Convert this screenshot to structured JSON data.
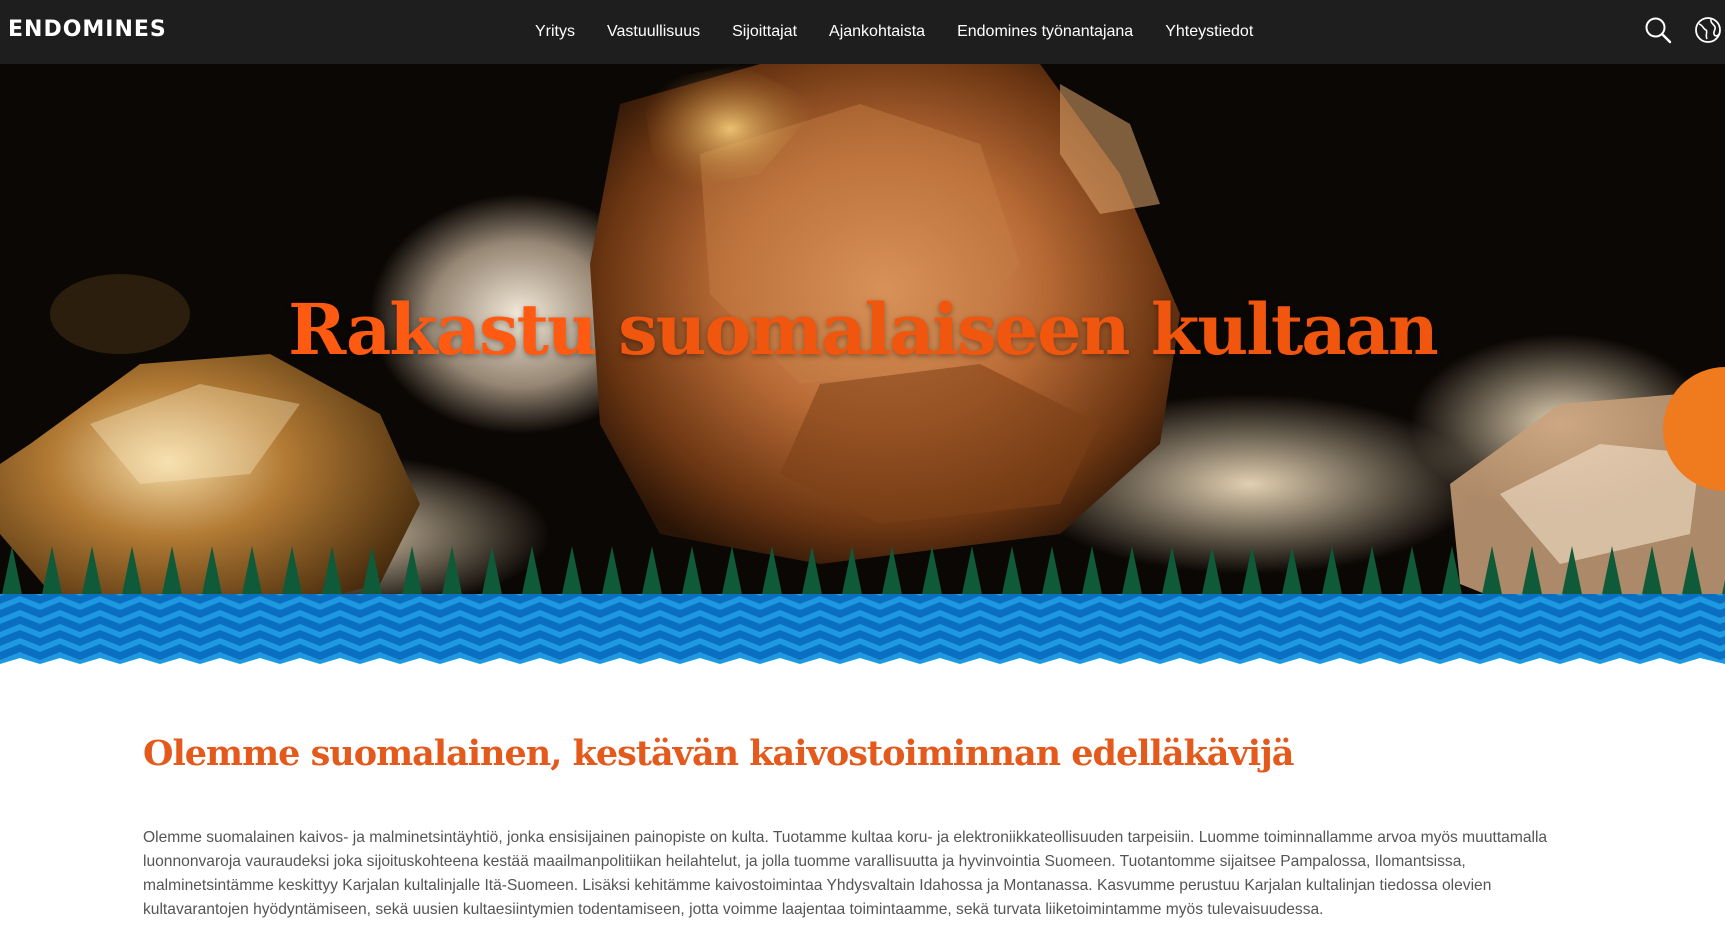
{
  "header": {
    "logo_text": "ENDOMINES",
    "nav": [
      {
        "label": "Yritys"
      },
      {
        "label": "Vastuullisuus"
      },
      {
        "label": "Sijoittajat"
      },
      {
        "label": "Ajankohtaista"
      },
      {
        "label": "Endomines työnantajana"
      },
      {
        "label": "Yhteystiedot"
      }
    ],
    "icons": {
      "search": "search-icon",
      "language": "globe-language-icon"
    }
  },
  "hero": {
    "title_part1": "Rakastu",
    "title_part2": "suomalaiseen kultaan",
    "background": "gold nugget video still",
    "decor": "pine tree row and blue wave pattern"
  },
  "content": {
    "heading": "Olemme suomalainen, kestävän kaivostoiminnan edelläkävijä",
    "paragraph": "Olemme suomalainen kaivos- ja malminetsintäyhtiö, jonka ensisijainen painopiste on kulta. Tuotamme kultaa koru- ja elektroniikkateollisuuden tarpeisiin. Luomme toiminnallamme arvoa myös muuttamalla luonnonvaroja vauraudeksi joka sijoituskohteena kestää maailmanpolitiikan heilahtelut, ja jolla tuomme varallisuutta ja hyvinvointia Suomeen. Tuotantomme sijaitsee Pampalossa, Ilomantsissa, malminetsintämme keskittyy Karjalan kultalinjalle Itä-Suomeen. Lisäksi kehitämme kaivostoimintaa Yhdysvaltain Idahossa ja Montanassa.  Kasvumme perustuu Karjalan kultalinjan tiedossa olevien kultavarantojen hyödyntämiseen, sekä uusien kultaesiintymien todentamiseen, jotta voimme laajentaa toimintaamme, sekä turvata liiketoimintamme myös tulevaisuudessa."
  },
  "colors": {
    "nav_background": "#1e1e1e",
    "brand_orange": "#f0560e",
    "heading_orange": "#e35a1c",
    "tree_green": "#0f5a38",
    "wave_blue": "#0a6fc0",
    "wave_light_blue": "#1e98e0",
    "body_text": "#555555"
  }
}
